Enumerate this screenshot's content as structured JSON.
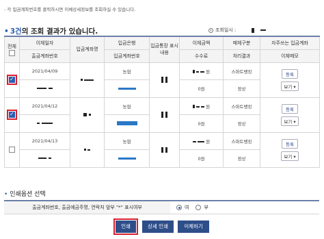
{
  "notice": "- 각 입금계좌번호를 클릭하시면 이체상세정보를 조회하실 수 있습니다.",
  "result": {
    "count_label": "3건",
    "suffix": "의 조회 결과가 있습니다."
  },
  "inquiry_label": "조회일시 :",
  "headers": {
    "all": "전체",
    "transfer_date": "이체일자",
    "out_account": "출금계좌번호",
    "depositor_name": "입금계좌명",
    "in_bank": "입금은행",
    "in_account": "입금계좌번호",
    "in_memo": "입금통장 표시내용",
    "amount": "이체금액",
    "fee": "수수료",
    "channel": "매체구분",
    "process_result": "처리결과",
    "frequent": "자주쓰는 입금계좌",
    "memo": "이체메모"
  },
  "rows": [
    {
      "date": "2021/04/09",
      "bank": "농협",
      "won": "원",
      "fee": "0원",
      "channel": "스마트뱅킹",
      "result": "정상",
      "action": "등록",
      "memo_select": "보기",
      "checked": true
    },
    {
      "date": "2021/04/12",
      "bank": "농협",
      "won": "원",
      "fee": "0원",
      "channel": "스마트뱅킹",
      "result": "정상",
      "action": "등록",
      "memo_select": "보기",
      "checked": true
    },
    {
      "date": "2021/04/13",
      "bank": "농협",
      "won": "원",
      "fee": "0원",
      "channel": "스마트뱅킹",
      "result": "정상",
      "action": "등록",
      "memo_select": "보기",
      "checked": false
    }
  ],
  "print_options": {
    "title": "인쇄옵션 선택",
    "label": "출금계좌번호, 출금예금주명, 연락처 앞부 \"*\" 표시여부",
    "yes": "여",
    "no": "부",
    "selected": "yes"
  },
  "buttons": {
    "print": "인쇄",
    "detail_print": "상세 인쇄",
    "transfer": "이체하기"
  },
  "colors": {
    "accent": "#2a5db0",
    "button": "#2e4e8a",
    "highlight": "#d8202f"
  }
}
